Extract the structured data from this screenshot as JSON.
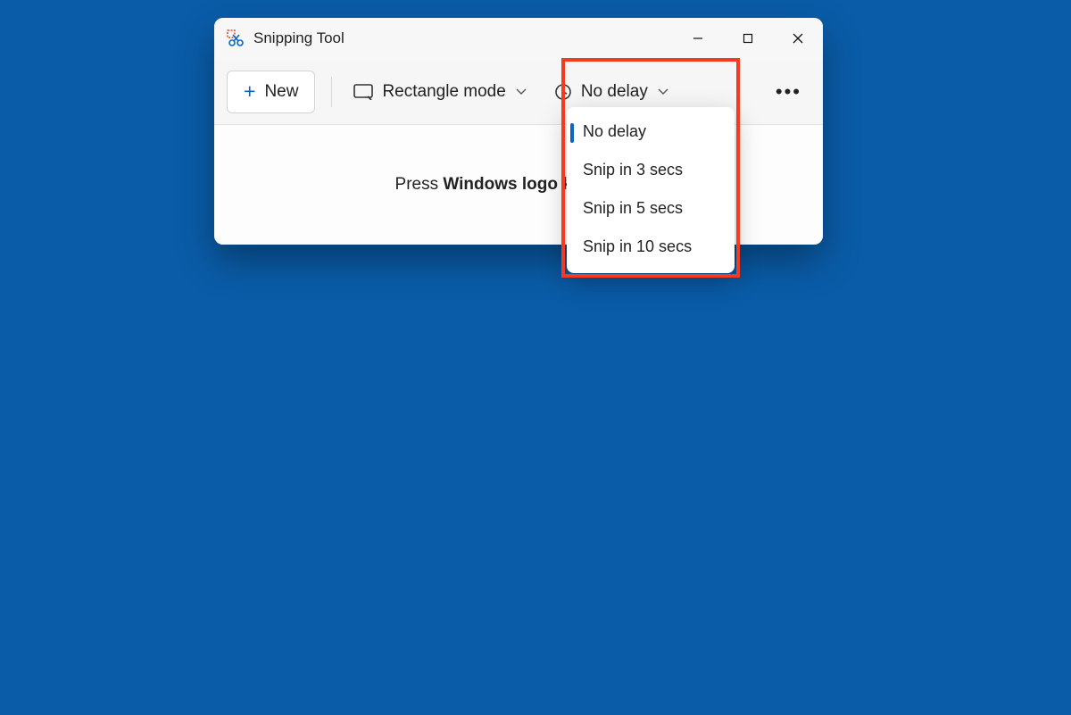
{
  "window": {
    "title": "Snipping Tool"
  },
  "toolbar": {
    "new_label": "New",
    "mode_label": "Rectangle mode",
    "delay_label": "No delay"
  },
  "hint": {
    "prefix": "Press ",
    "bold": "Windows logo key + Shif"
  },
  "delay_menu": {
    "items": [
      {
        "label": "No delay",
        "selected": true
      },
      {
        "label": "Snip in 3 secs",
        "selected": false
      },
      {
        "label": "Snip in 5 secs",
        "selected": false
      },
      {
        "label": "Snip in 10 secs",
        "selected": false
      }
    ]
  },
  "colors": {
    "accent": "#0a66c2",
    "highlight": "#f33b1f",
    "desktop": "#0a5ca8"
  }
}
